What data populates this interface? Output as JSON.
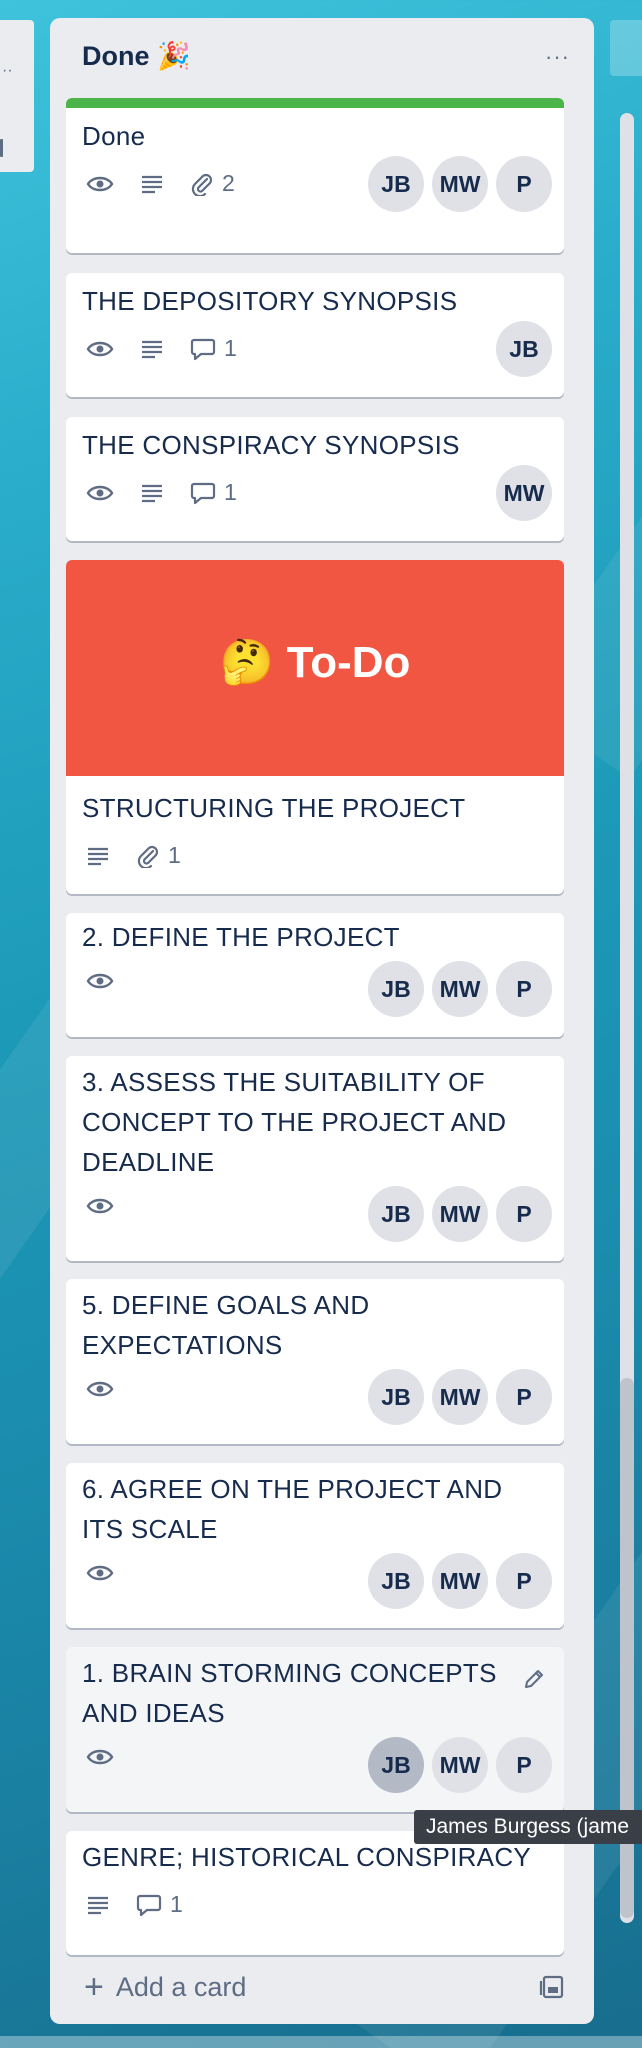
{
  "list": {
    "title": "Done 🎉",
    "menu_label": "···",
    "add_card_label": "Add a card",
    "add_card_icon": "plus-icon",
    "template_icon": "card-template-icon"
  },
  "cards": [
    {
      "title": "Done",
      "label_color": "#4bb54a",
      "badges": {
        "watch": true,
        "description": true,
        "attachments": "2"
      },
      "members": [
        "JB",
        "MW",
        "P"
      ]
    },
    {
      "title": "THE DEPOSITORY SYNOPSIS",
      "badges": {
        "watch": true,
        "description": true,
        "comments": "1"
      },
      "members": [
        "JB"
      ]
    },
    {
      "title": "THE CONSPIRACY SYNOPSIS",
      "badges": {
        "watch": true,
        "description": true,
        "comments": "1"
      },
      "members": [
        "MW"
      ]
    },
    {
      "cover_text": "🤔 To-Do",
      "cover_color": "#f15643",
      "title": "STRUCTURING THE PROJECT",
      "badges": {
        "description": true,
        "attachments": "1"
      }
    },
    {
      "title": "2. DEFINE THE PROJECT",
      "badges": {
        "watch": true
      },
      "members": [
        "JB",
        "MW",
        "P"
      ]
    },
    {
      "title_lines": [
        "3. ASSESS THE SUITABILITY OF",
        "CONCEPT TO THE PROJECT AND",
        "DEADLINE"
      ],
      "badges": {
        "watch": true
      },
      "members": [
        "JB",
        "MW",
        "P"
      ]
    },
    {
      "title_lines": [
        "5. DEFINE GOALS AND",
        "EXPECTATIONS"
      ],
      "badges": {
        "watch": true
      },
      "members": [
        "JB",
        "MW",
        "P"
      ]
    },
    {
      "title_lines": [
        "6. AGREE ON THE PROJECT AND",
        "ITS SCALE"
      ],
      "badges": {
        "watch": true
      },
      "members": [
        "JB",
        "MW",
        "P"
      ]
    },
    {
      "title_lines": [
        "1. BRAIN STORMING CONCEPTS",
        "AND IDEAS"
      ],
      "badges": {
        "watch": true
      },
      "members": [
        "JB",
        "MW",
        "P"
      ]
    },
    {
      "title": "GENRE; HISTORICAL CONSPIRACY",
      "badges": {
        "description": true,
        "comments": "1"
      }
    }
  ],
  "tooltip": "James Burgess (jame"
}
